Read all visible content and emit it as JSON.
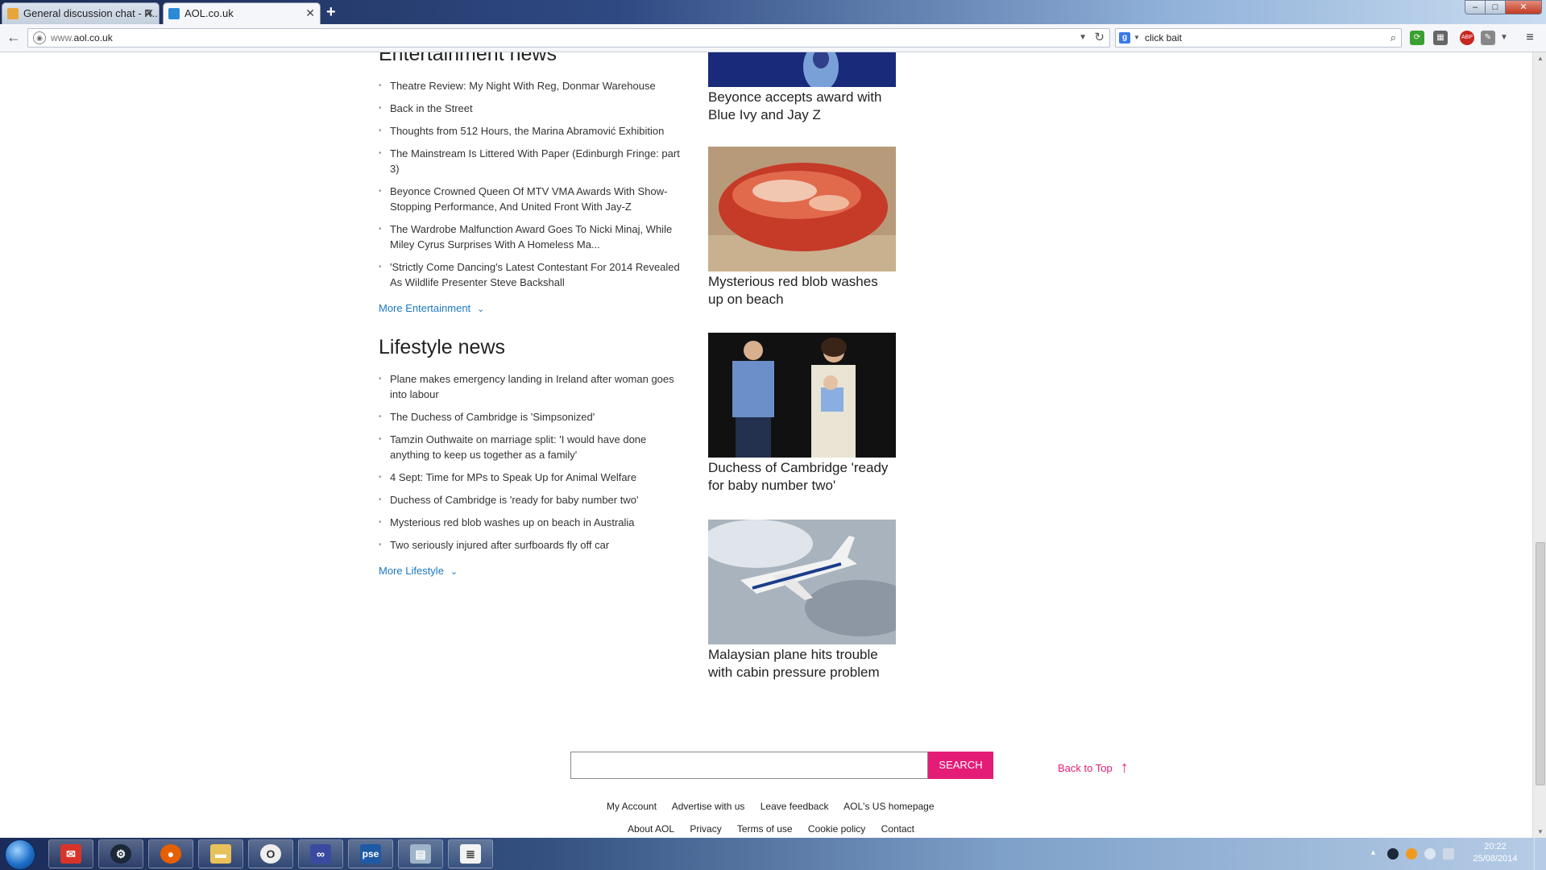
{
  "browser": {
    "tabs": [
      {
        "label": "General discussion chat - R...",
        "active": false
      },
      {
        "label": "AOL.co.uk",
        "active": true
      }
    ],
    "new_tab_label": "+",
    "url_prefix": "www.",
    "url_domain": "aol.co.uk",
    "search_value": "click bait",
    "window_buttons": {
      "minimize": "–",
      "maximize": "□",
      "close": "✕"
    },
    "toolbar_icons": [
      "refresh-extension-icon",
      "grid-icon",
      "adblock-icon",
      "tools-icon",
      "menu-icon"
    ],
    "adblock_label": "ABP"
  },
  "page": {
    "entertainment": {
      "title": "Entertainment news",
      "items": [
        "Theatre Review: My Night With Reg, Donmar Warehouse",
        "Back in the Street",
        "Thoughts from 512 Hours, the Marina Abramović Exhibition",
        "The Mainstream Is Littered With Paper (Edinburgh Fringe: part 3)",
        "Beyonce Crowned Queen Of MTV VMA Awards With Show-Stopping Performance, And United Front With Jay-Z",
        "The Wardrobe Malfunction Award Goes To Nicki Minaj, While Miley Cyrus Surprises With A Homeless Ma...",
        "'Strictly Come Dancing's Latest Contestant For 2014 Revealed As Wildlife Presenter Steve Backshall"
      ],
      "more": "More Entertainment"
    },
    "lifestyle": {
      "title": "Lifestyle news",
      "items": [
        "Plane makes emergency landing in Ireland after woman goes into labour",
        "The Duchess of Cambridge is 'Simpsonized'",
        "Tamzin Outhwaite on marriage split: 'I would have done anything to keep us together as a family'",
        "4 Sept: Time for MPs to Speak Up for Animal Welfare",
        "Duchess of Cambridge is 'ready for baby number two'",
        "Mysterious red blob washes up on beach in Australia",
        "Two seriously injured after surfboards fly off car"
      ],
      "more": "More Lifestyle"
    },
    "cards": [
      "Beyonce accepts award with Blue Ivy and Jay Z",
      "Mysterious red blob washes up on beach",
      "Duchess of Cambridge 'ready for baby number two'",
      "Malaysian plane hits trouble with cabin pressure problem"
    ],
    "search_button": "SEARCH",
    "back_to_top": "Back to Top",
    "footer_row1": [
      "My Account",
      "Advertise with us",
      "Leave feedback",
      "AOL's US homepage"
    ],
    "footer_row2": [
      "About AOL",
      "Privacy",
      "Terms of use",
      "Cookie policy",
      "Contact"
    ]
  },
  "taskbar": {
    "apps": [
      "gmail",
      "steam",
      "firefox",
      "explorer",
      "opera",
      "infinity",
      "pse",
      "calculator",
      "notepad"
    ],
    "pse_label": "pse",
    "time": "20:22",
    "date": "25/08/2014"
  },
  "colors": {
    "accent_pink": "#e51c77",
    "link_blue": "#1a78c2"
  }
}
